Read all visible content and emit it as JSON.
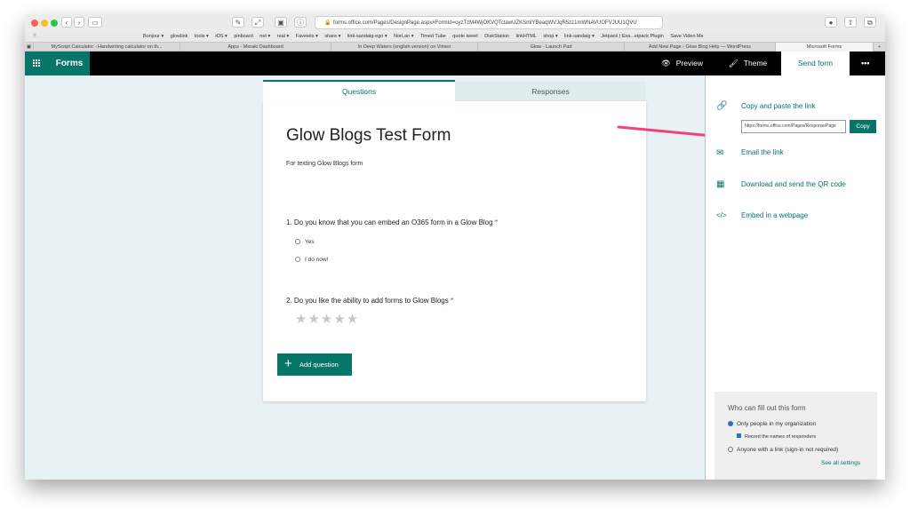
{
  "browser": {
    "url": "forms.office.com/Pages/DesignPage.aspx#FormId=oyzTzM4WjOKVQTctawUZKSmlYBeaqWVJqR5zz1mWNAVUOFVJUU1QVU",
    "bookmarks": [
      "Bonjour ▾",
      "glowlink",
      "tools ▾",
      "iOS ▾",
      "pinboard",
      "net ▾",
      "real ▾",
      "Faveiets ▾",
      "share ▾",
      "link-sandaig-ego ▾",
      "NorLan ▾",
      "Timed Tube",
      "quote tweet",
      "DiskStation",
      "linkHTML",
      "shop ▾",
      "link-sandaig ▾",
      "Jetpack | Exa...etpack Plugin",
      "Save Video Me"
    ],
    "tabs": [
      "MyScript Calculator - Handwriting calculator on th...",
      "Apps - Meraki Dashboard",
      "In Deep Waters (english version) on Vimeo",
      "Glow - Launch Pad",
      "Add New Page ‹ Glow Blog Help — WordPress",
      "Microsoft Forms"
    ]
  },
  "header": {
    "app_name": "Forms",
    "preview": "Preview",
    "theme": "Theme",
    "send_form": "Send form",
    "more": "•••"
  },
  "form": {
    "tab_questions": "Questions",
    "tab_responses": "Responses",
    "title": "Glow Blogs Test Form",
    "description": "For texting Glow Blogs form",
    "q1": "1. Do you know that you can embed an O365 form in a Glow Blog",
    "q1_options": [
      "Yes",
      "I do now!"
    ],
    "q2": "2. Do you like the ability to add forms to Glow Blogs",
    "required_mark": "*",
    "stars": "★★★★★",
    "add_question": "Add question"
  },
  "share": {
    "copy_link_label": "Copy and paste the link",
    "link_value": "https://forms.office.com/Pages/ResponsePage",
    "copy_button": "Copy",
    "email": "Email the link",
    "qr": "Download and send the QR code",
    "embed": "Embed in a webpage",
    "who_title": "Who can fill out this form",
    "only_org": "Only people in my organization",
    "record_names": "Record the names of responders",
    "anyone": "Anyone with a link (sign-in not required)",
    "see_all": "See all settings"
  },
  "colors": {
    "accent": "#077568",
    "arrow": "#f0437a"
  }
}
